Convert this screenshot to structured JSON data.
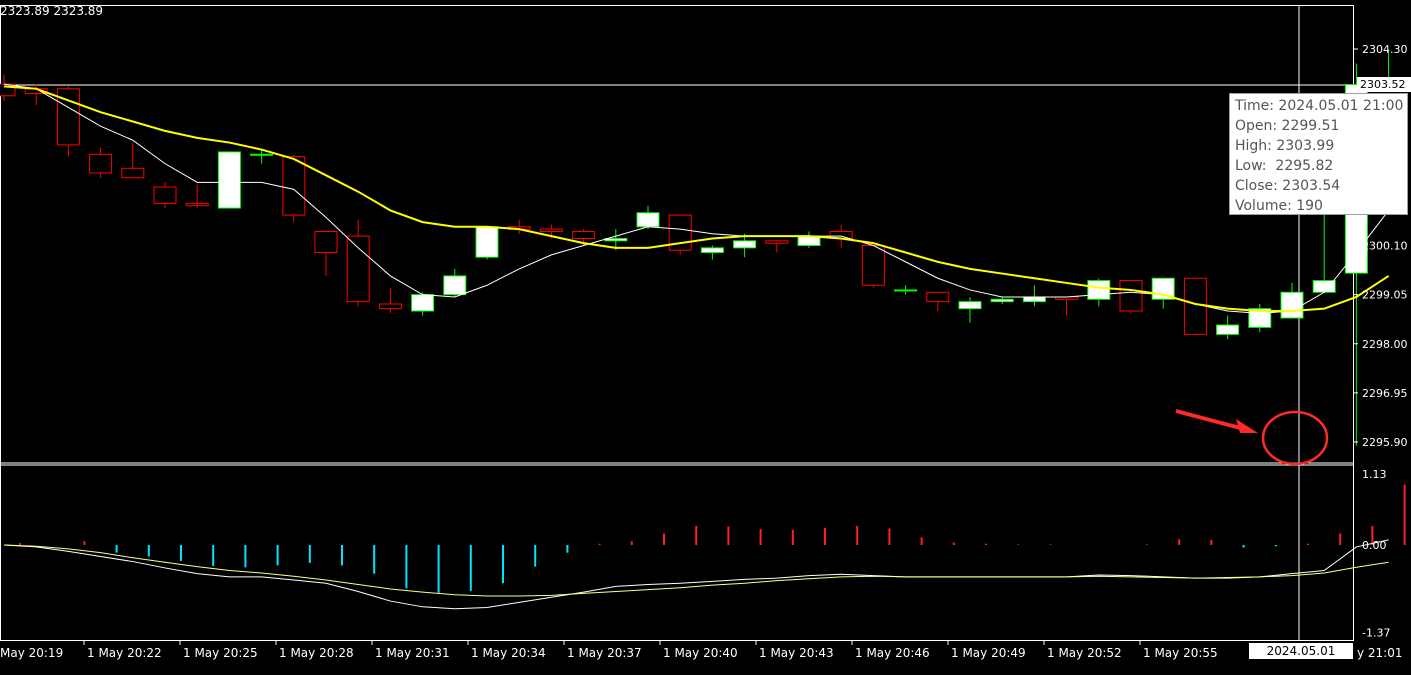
{
  "header": {
    "symbol_prices": "2323.89 2323.89"
  },
  "colors": {
    "background": "#000000",
    "bull_body": "#ffffff",
    "bull_outline": "#00ff00",
    "bear_outline": "#ff0000",
    "ma_slow": "#ffff00",
    "ma_fast": "#ffffff",
    "hist_neg": "#00e5ff",
    "hist_pos": "#ff2020",
    "annotation": "#ff2a2a"
  },
  "price_axis": {
    "ticks": [
      "2304.30",
      "2303.52",
      "2300.10",
      "2299.05",
      "2298.00",
      "2296.95",
      "2295.90"
    ],
    "current_price": "2303.52"
  },
  "indicator_axis": {
    "ticks": [
      "1.13",
      "0.00",
      "-1.37"
    ]
  },
  "time_axis": {
    "labels": [
      "May 20:19",
      "1 May 20:22",
      "1 May 20:25",
      "1 May 20:28",
      "1 May 20:31",
      "1 May 20:34",
      "1 May 20:37",
      "1 May 20:40",
      "1 May 20:43",
      "1 May 20:46",
      "1 May 20:49",
      "1 May 20:52",
      "1 May 20:55",
      "y 21:01"
    ],
    "crosshair_time": "2024.05.01 21:00"
  },
  "tooltip": {
    "time": "Time: 2024.05.01 21:00",
    "open": "Open: 2299.51",
    "high": "High: 2303.99",
    "low": "Low:  2295.82",
    "close": "Close: 2303.54",
    "volume": "Volume: 190"
  },
  "chart_data": {
    "type": "candlestick",
    "ylim": [
      2295.5,
      2304.8
    ],
    "candles": [
      {
        "o": 2303.55,
        "h": 2303.75,
        "l": 2303.2,
        "c": 2303.3
      },
      {
        "o": 2303.45,
        "h": 2303.55,
        "l": 2303.1,
        "c": 2303.35
      },
      {
        "o": 2303.45,
        "h": 2303.5,
        "l": 2302.0,
        "c": 2302.25
      },
      {
        "o": 2302.05,
        "h": 2302.2,
        "l": 2301.55,
        "c": 2301.65
      },
      {
        "o": 2301.75,
        "h": 2302.3,
        "l": 2301.55,
        "c": 2301.55
      },
      {
        "o": 2301.35,
        "h": 2301.45,
        "l": 2300.9,
        "c": 2301.0
      },
      {
        "o": 2301.0,
        "h": 2301.4,
        "l": 2300.9,
        "c": 2300.95
      },
      {
        "o": 2300.9,
        "h": 2302.1,
        "l": 2300.9,
        "c": 2302.1
      },
      {
        "o": 2302.05,
        "h": 2302.15,
        "l": 2301.85,
        "c": 2302.05
      },
      {
        "o": 2302.0,
        "h": 2302.05,
        "l": 2300.6,
        "c": 2300.75
      },
      {
        "o": 2300.4,
        "h": 2300.4,
        "l": 2299.45,
        "c": 2299.95
      },
      {
        "o": 2300.3,
        "h": 2300.65,
        "l": 2298.8,
        "c": 2298.9
      },
      {
        "o": 2298.85,
        "h": 2299.2,
        "l": 2298.65,
        "c": 2298.75
      },
      {
        "o": 2298.7,
        "h": 2299.1,
        "l": 2298.6,
        "c": 2299.05
      },
      {
        "o": 2299.05,
        "h": 2299.6,
        "l": 2299.0,
        "c": 2299.45
      },
      {
        "o": 2299.85,
        "h": 2300.5,
        "l": 2299.8,
        "c": 2300.5
      },
      {
        "o": 2300.5,
        "h": 2300.65,
        "l": 2300.35,
        "c": 2300.45
      },
      {
        "o": 2300.45,
        "h": 2300.55,
        "l": 2300.25,
        "c": 2300.4
      },
      {
        "o": 2300.4,
        "h": 2300.45,
        "l": 2300.1,
        "c": 2300.25
      },
      {
        "o": 2300.2,
        "h": 2300.45,
        "l": 2300.0,
        "c": 2300.25
      },
      {
        "o": 2300.5,
        "h": 2300.95,
        "l": 2300.45,
        "c": 2300.8
      },
      {
        "o": 2300.75,
        "h": 2300.75,
        "l": 2299.9,
        "c": 2300.0
      },
      {
        "o": 2299.95,
        "h": 2300.1,
        "l": 2299.8,
        "c": 2300.05
      },
      {
        "o": 2300.05,
        "h": 2300.35,
        "l": 2299.85,
        "c": 2300.2
      },
      {
        "o": 2300.2,
        "h": 2300.2,
        "l": 2299.95,
        "c": 2300.15
      },
      {
        "o": 2300.1,
        "h": 2300.4,
        "l": 2300.05,
        "c": 2300.3
      },
      {
        "o": 2300.4,
        "h": 2300.55,
        "l": 2300.05,
        "c": 2300.25
      },
      {
        "o": 2300.1,
        "h": 2300.1,
        "l": 2299.2,
        "c": 2299.25
      },
      {
        "o": 2299.15,
        "h": 2299.25,
        "l": 2299.05,
        "c": 2299.15
      },
      {
        "o": 2299.1,
        "h": 2299.1,
        "l": 2298.7,
        "c": 2298.9
      },
      {
        "o": 2298.75,
        "h": 2299.0,
        "l": 2298.45,
        "c": 2298.9
      },
      {
        "o": 2298.9,
        "h": 2299.0,
        "l": 2298.85,
        "c": 2298.95
      },
      {
        "o": 2298.9,
        "h": 2299.25,
        "l": 2298.8,
        "c": 2299.0
      },
      {
        "o": 2299.0,
        "h": 2299.0,
        "l": 2298.6,
        "c": 2298.95
      },
      {
        "o": 2298.95,
        "h": 2299.4,
        "l": 2298.8,
        "c": 2299.35
      },
      {
        "o": 2299.35,
        "h": 2299.35,
        "l": 2298.65,
        "c": 2298.7
      },
      {
        "o": 2298.95,
        "h": 2299.15,
        "l": 2298.75,
        "c": 2299.4
      },
      {
        "o": 2299.4,
        "h": 2299.4,
        "l": 2298.2,
        "c": 2298.2
      },
      {
        "o": 2298.2,
        "h": 2298.6,
        "l": 2298.1,
        "c": 2298.4
      },
      {
        "o": 2298.35,
        "h": 2298.85,
        "l": 2298.25,
        "c": 2298.75
      },
      {
        "o": 2298.55,
        "h": 2299.3,
        "l": 2298.55,
        "c": 2299.1
      },
      {
        "o": 2299.1,
        "h": 2300.95,
        "l": 2299.1,
        "c": 2299.35
      },
      {
        "o": 2299.51,
        "h": 2303.99,
        "l": 2295.82,
        "c": 2303.54
      },
      {
        "o": 2303.5,
        "h": 2304.25,
        "l": 2303.45,
        "c": 2303.52
      }
    ],
    "ma_slow": [
      2303.5,
      2303.45,
      2303.2,
      2302.95,
      2302.75,
      2302.55,
      2302.4,
      2302.3,
      2302.15,
      2301.95,
      2301.6,
      2301.25,
      2300.85,
      2300.6,
      2300.5,
      2300.5,
      2300.45,
      2300.3,
      2300.15,
      2300.05,
      2300.05,
      2300.15,
      2300.25,
      2300.3,
      2300.3,
      2300.3,
      2300.25,
      2300.15,
      2299.95,
      2299.75,
      2299.6,
      2299.5,
      2299.4,
      2299.3,
      2299.2,
      2299.15,
      2299.05,
      2298.85,
      2298.75,
      2298.7,
      2298.7,
      2298.75,
      2299.0,
      2299.45
    ],
    "ma_fast": [
      2303.55,
      2303.45,
      2303.05,
      2302.65,
      2302.35,
      2301.85,
      2301.45,
      2301.45,
      2301.45,
      2301.3,
      2300.7,
      2300.05,
      2299.45,
      2299.05,
      2299.0,
      2299.25,
      2299.6,
      2299.9,
      2300.1,
      2300.3,
      2300.5,
      2300.45,
      2300.35,
      2300.3,
      2300.3,
      2300.3,
      2300.3,
      2300.1,
      2299.75,
      2299.4,
      2299.15,
      2299.0,
      2299.0,
      2299.0,
      2299.05,
      2299.1,
      2299.05,
      2298.85,
      2298.7,
      2298.65,
      2298.7,
      2299.1,
      2299.95,
      2300.85
    ],
    "indicator": {
      "ylim": [
        -1.37,
        1.13
      ],
      "histogram": [
        0.03,
        0.0,
        0.06,
        -0.12,
        -0.18,
        -0.25,
        -0.33,
        -0.35,
        -0.32,
        -0.28,
        -0.32,
        -0.45,
        -0.68,
        -0.75,
        -0.72,
        -0.6,
        -0.34,
        -0.12,
        0.02,
        0.06,
        0.18,
        0.3,
        0.29,
        0.25,
        0.24,
        0.27,
        0.3,
        0.26,
        0.12,
        0.04,
        0.02,
        0.01,
        0.01,
        0.0,
        0.0,
        0.01,
        0.09,
        0.08,
        -0.04,
        -0.02,
        0.02,
        0.18,
        0.3,
        0.95,
        1.13
      ],
      "signal_fast": [
        0.0,
        -0.03,
        -0.1,
        -0.18,
        -0.26,
        -0.36,
        -0.45,
        -0.5,
        -0.5,
        -0.55,
        -0.6,
        -0.73,
        -0.88,
        -0.97,
        -1.0,
        -0.98,
        -0.9,
        -0.82,
        -0.74,
        -0.65,
        -0.62,
        -0.6,
        -0.57,
        -0.54,
        -0.52,
        -0.48,
        -0.46,
        -0.48,
        -0.5,
        -0.5,
        -0.5,
        -0.5,
        -0.5,
        -0.5,
        -0.47,
        -0.48,
        -0.5,
        -0.52,
        -0.52,
        -0.5,
        -0.45,
        -0.4,
        -0.03,
        0.08
      ],
      "signal_slow": [
        0.0,
        -0.02,
        -0.06,
        -0.12,
        -0.2,
        -0.27,
        -0.34,
        -0.4,
        -0.44,
        -0.49,
        -0.55,
        -0.62,
        -0.69,
        -0.74,
        -0.78,
        -0.8,
        -0.8,
        -0.79,
        -0.76,
        -0.73,
        -0.7,
        -0.67,
        -0.63,
        -0.6,
        -0.56,
        -0.53,
        -0.5,
        -0.49,
        -0.5,
        -0.5,
        -0.5,
        -0.5,
        -0.5,
        -0.5,
        -0.49,
        -0.5,
        -0.51,
        -0.52,
        -0.51,
        -0.5,
        -0.48,
        -0.44,
        -0.35,
        -0.27
      ]
    }
  }
}
